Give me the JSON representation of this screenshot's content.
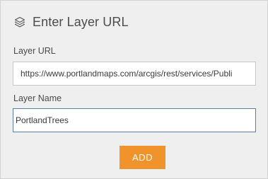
{
  "header": {
    "title": "Enter Layer URL",
    "icon": "layers-icon"
  },
  "form": {
    "url_label": "Layer URL",
    "url_value": "https://www.portlandmaps.com/arcgis/rest/services/Publi",
    "name_label": "Layer Name",
    "name_value": "PortlandTrees",
    "add_label": "ADD"
  },
  "colors": {
    "panel_background": "#efefef",
    "add_button": "#f0932b",
    "focused_border": "#5a7fa8"
  }
}
